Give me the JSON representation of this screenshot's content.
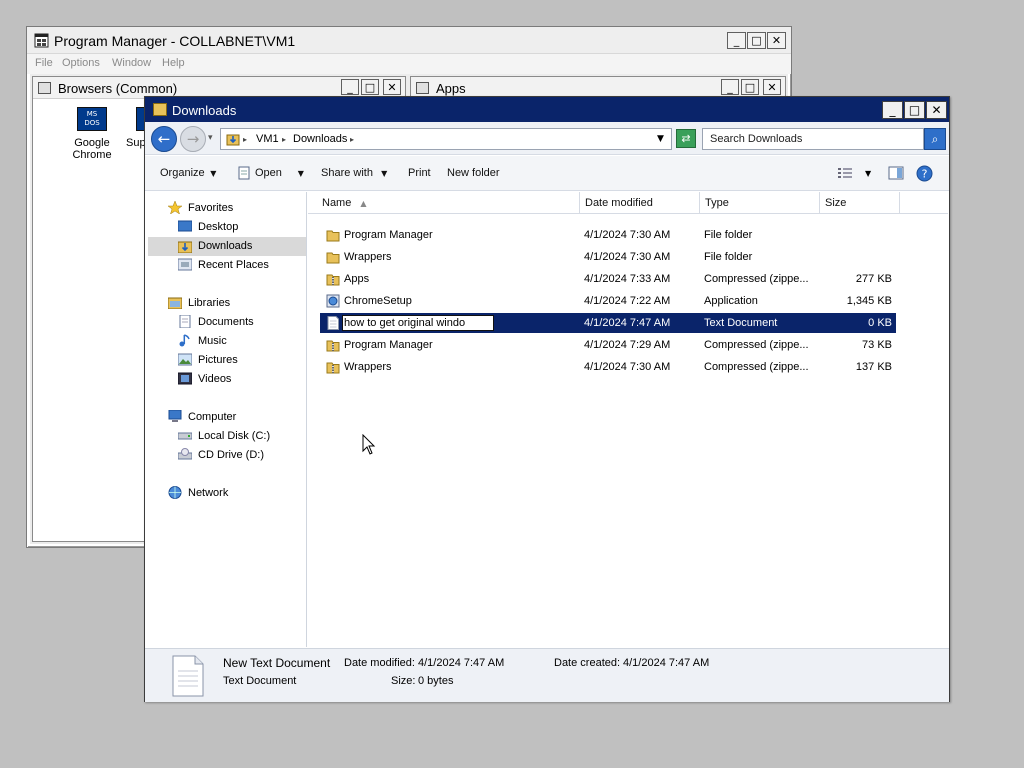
{
  "program_manager": {
    "title": "Program Manager - COLLABNET\\VM1",
    "menu": [
      "File",
      "Options",
      "Window",
      "Help"
    ],
    "browsers_group": {
      "title": "Browsers (Common)",
      "items": [
        {
          "label_line1": "Google",
          "label_line2": "Chrome",
          "icon_text": "MS DOS"
        },
        {
          "label_line1": "Supe",
          "label_line2": ""
        }
      ]
    },
    "apps_group": {
      "title": "Apps"
    }
  },
  "explorer": {
    "title": "Downloads",
    "window_buttons": {
      "minimize": "_",
      "maximize": "□",
      "close": "✕"
    },
    "address": {
      "segments": [
        "VM1",
        "Downloads"
      ],
      "separator": "▸"
    },
    "search": {
      "placeholder": "Search Downloads"
    },
    "toolbar": {
      "organize": "Organize",
      "open": "Open",
      "share_with": "Share with",
      "print": "Print",
      "new_folder": "New folder"
    },
    "nav": {
      "favorites": "Favorites",
      "desktop": "Desktop",
      "downloads": "Downloads",
      "recent_places": "Recent Places",
      "libraries": "Libraries",
      "documents": "Documents",
      "music": "Music",
      "pictures": "Pictures",
      "videos": "Videos",
      "computer": "Computer",
      "local_disk": "Local Disk (C:)",
      "cd_drive": "CD Drive (D:)",
      "network": "Network"
    },
    "columns": {
      "name": "Name",
      "date": "Date modified",
      "type": "Type",
      "size": "Size"
    },
    "files": [
      {
        "name": "Program Manager",
        "date": "4/1/2024 7:30 AM",
        "type": "File folder",
        "size": "",
        "icon": "folder-icon"
      },
      {
        "name": "Wrappers",
        "date": "4/1/2024 7:30 AM",
        "type": "File folder",
        "size": "",
        "icon": "folder-icon"
      },
      {
        "name": "Apps",
        "date": "4/1/2024 7:33 AM",
        "type": "Compressed (zippe...",
        "size": "277 KB",
        "icon": "zip-folder-icon"
      },
      {
        "name": "ChromeSetup",
        "date": "4/1/2024 7:22 AM",
        "type": "Application",
        "size": "1,345 KB",
        "icon": "application-icon"
      },
      {
        "name": "how to get original windo",
        "date": "4/1/2024 7:47 AM",
        "type": "Text Document",
        "size": "0 KB",
        "icon": "text-document-icon",
        "renaming": true
      },
      {
        "name": "Program Manager",
        "date": "4/1/2024 7:29 AM",
        "type": "Compressed (zippe...",
        "size": "73 KB",
        "icon": "zip-folder-icon"
      },
      {
        "name": "Wrappers",
        "date": "4/1/2024 7:30 AM",
        "type": "Compressed (zippe...",
        "size": "137 KB",
        "icon": "zip-folder-icon"
      }
    ],
    "details": {
      "name": "New Text Document",
      "type": "Text Document",
      "date_modified_label": "Date modified:",
      "date_modified": "4/1/2024 7:47 AM",
      "date_created_label": "Date created:",
      "date_created": "4/1/2024 7:47 AM",
      "size_label": "Size:",
      "size": "0 bytes"
    }
  },
  "colors": {
    "title_active": "#0a246a",
    "selection": "#0a246a",
    "desktop": "#c0c0c0"
  }
}
